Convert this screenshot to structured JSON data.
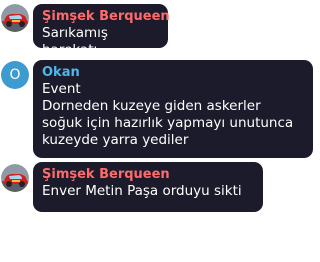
{
  "messages": [
    {
      "sender": "Şimşek Berqueen",
      "sender_color": "#ff6b6b",
      "avatar": {
        "type": "image",
        "icon": "race-car-avatar-icon"
      },
      "text": "Sarıkamış harekatı"
    },
    {
      "sender": "Okan",
      "sender_color": "#4fb8e8",
      "avatar": {
        "type": "letter",
        "letter": "O",
        "color": "#3d9bd0"
      },
      "text": "Event\nDorneden kuzeye giden askerler\nsoğuk için hazırlık yapmayı unutunca\nkuzeyde yarra yediler"
    },
    {
      "sender": "Şimşek Berqueen",
      "sender_color": "#ff6b6b",
      "avatar": {
        "type": "image",
        "icon": "race-car-avatar-icon"
      },
      "text": "Enver Metin Paşa orduyu sikti"
    }
  ],
  "colors": {
    "bubble_bg": "#1b1b2b",
    "text": "#ffffff",
    "page_bg": "#ffffff"
  }
}
